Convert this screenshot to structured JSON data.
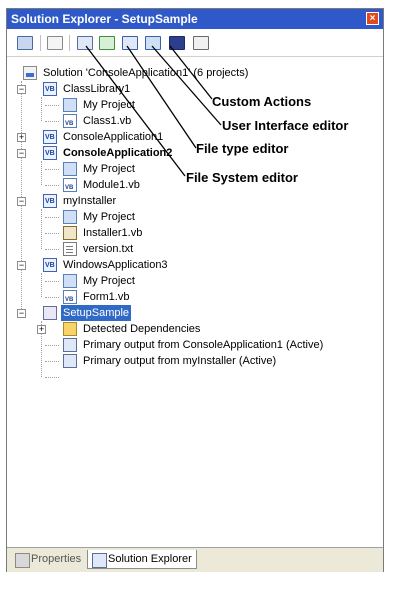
{
  "window": {
    "title": "Solution Explorer - SetupSample",
    "close_glyph": "×"
  },
  "toolbar": {
    "buttons": [
      {
        "name": "properties-icon"
      },
      {
        "name": "show-all-files-icon"
      },
      {
        "name": "file-system-editor-icon"
      },
      {
        "name": "registry-editor-icon"
      },
      {
        "name": "file-type-editor-icon"
      },
      {
        "name": "user-interface-editor-icon"
      },
      {
        "name": "custom-actions-editor-icon"
      },
      {
        "name": "launch-conditions-editor-icon"
      }
    ]
  },
  "tree": {
    "solution": "Solution 'ConsoleApplication1' (6 projects)",
    "class_library": {
      "label": "ClassLibrary1",
      "children": [
        "My Project",
        "Class1.vb"
      ]
    },
    "console_app1": {
      "label": "ConsoleApplication1"
    },
    "console_app2": {
      "label": "ConsoleApplication2",
      "children": [
        "My Project",
        "Module1.vb"
      ]
    },
    "my_installer": {
      "label": "myInstaller",
      "children": [
        "My Project",
        "Installer1.vb",
        "version.txt"
      ]
    },
    "windows_app3": {
      "label": "WindowsApplication3",
      "children": [
        "My Project",
        "Form1.vb"
      ]
    },
    "setup_sample": {
      "label": "SetupSample",
      "children": [
        "Detected Dependencies",
        "Primary output from ConsoleApplication1 (Active)",
        "Primary output from myInstaller (Active)"
      ]
    }
  },
  "callouts": {
    "custom_actions": "Custom Actions",
    "ui_editor": "User Interface editor",
    "file_type_editor": "File type editor",
    "file_system_editor": "File System editor"
  },
  "bottom_tabs": {
    "properties": "Properties",
    "solution_explorer": "Solution Explorer"
  }
}
